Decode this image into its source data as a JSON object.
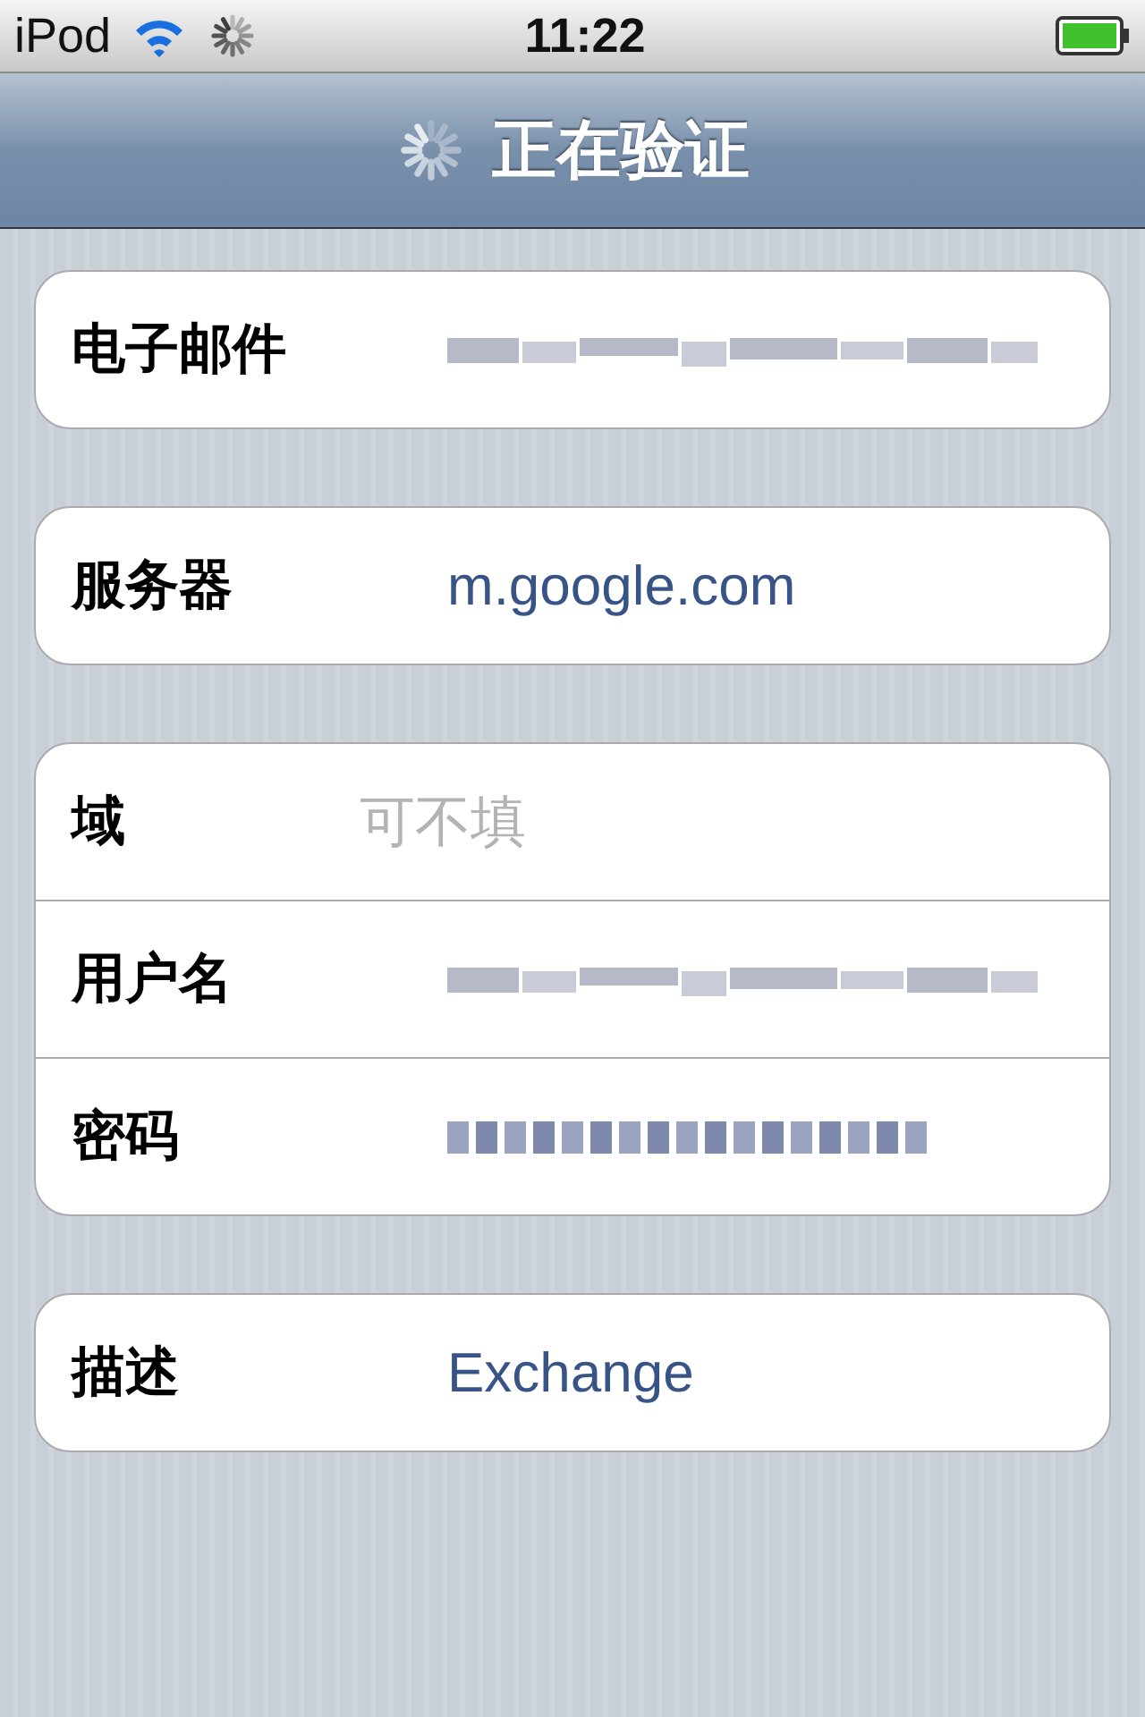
{
  "status_bar": {
    "carrier": "iPod",
    "time": "11:22"
  },
  "nav_bar": {
    "title": "正在验证",
    "loading": true
  },
  "groups": [
    {
      "rows": [
        {
          "label": "电子邮件",
          "kind": "redacted"
        }
      ]
    },
    {
      "rows": [
        {
          "label": "服务器",
          "kind": "value",
          "value": "m.google.com"
        }
      ]
    },
    {
      "rows": [
        {
          "label": "域",
          "kind": "placeholder",
          "placeholder": "可不填"
        },
        {
          "label": "用户名",
          "kind": "redacted"
        },
        {
          "label": "密码",
          "kind": "password"
        }
      ]
    },
    {
      "rows": [
        {
          "label": "描述",
          "kind": "value",
          "value": "Exchange"
        }
      ]
    }
  ]
}
